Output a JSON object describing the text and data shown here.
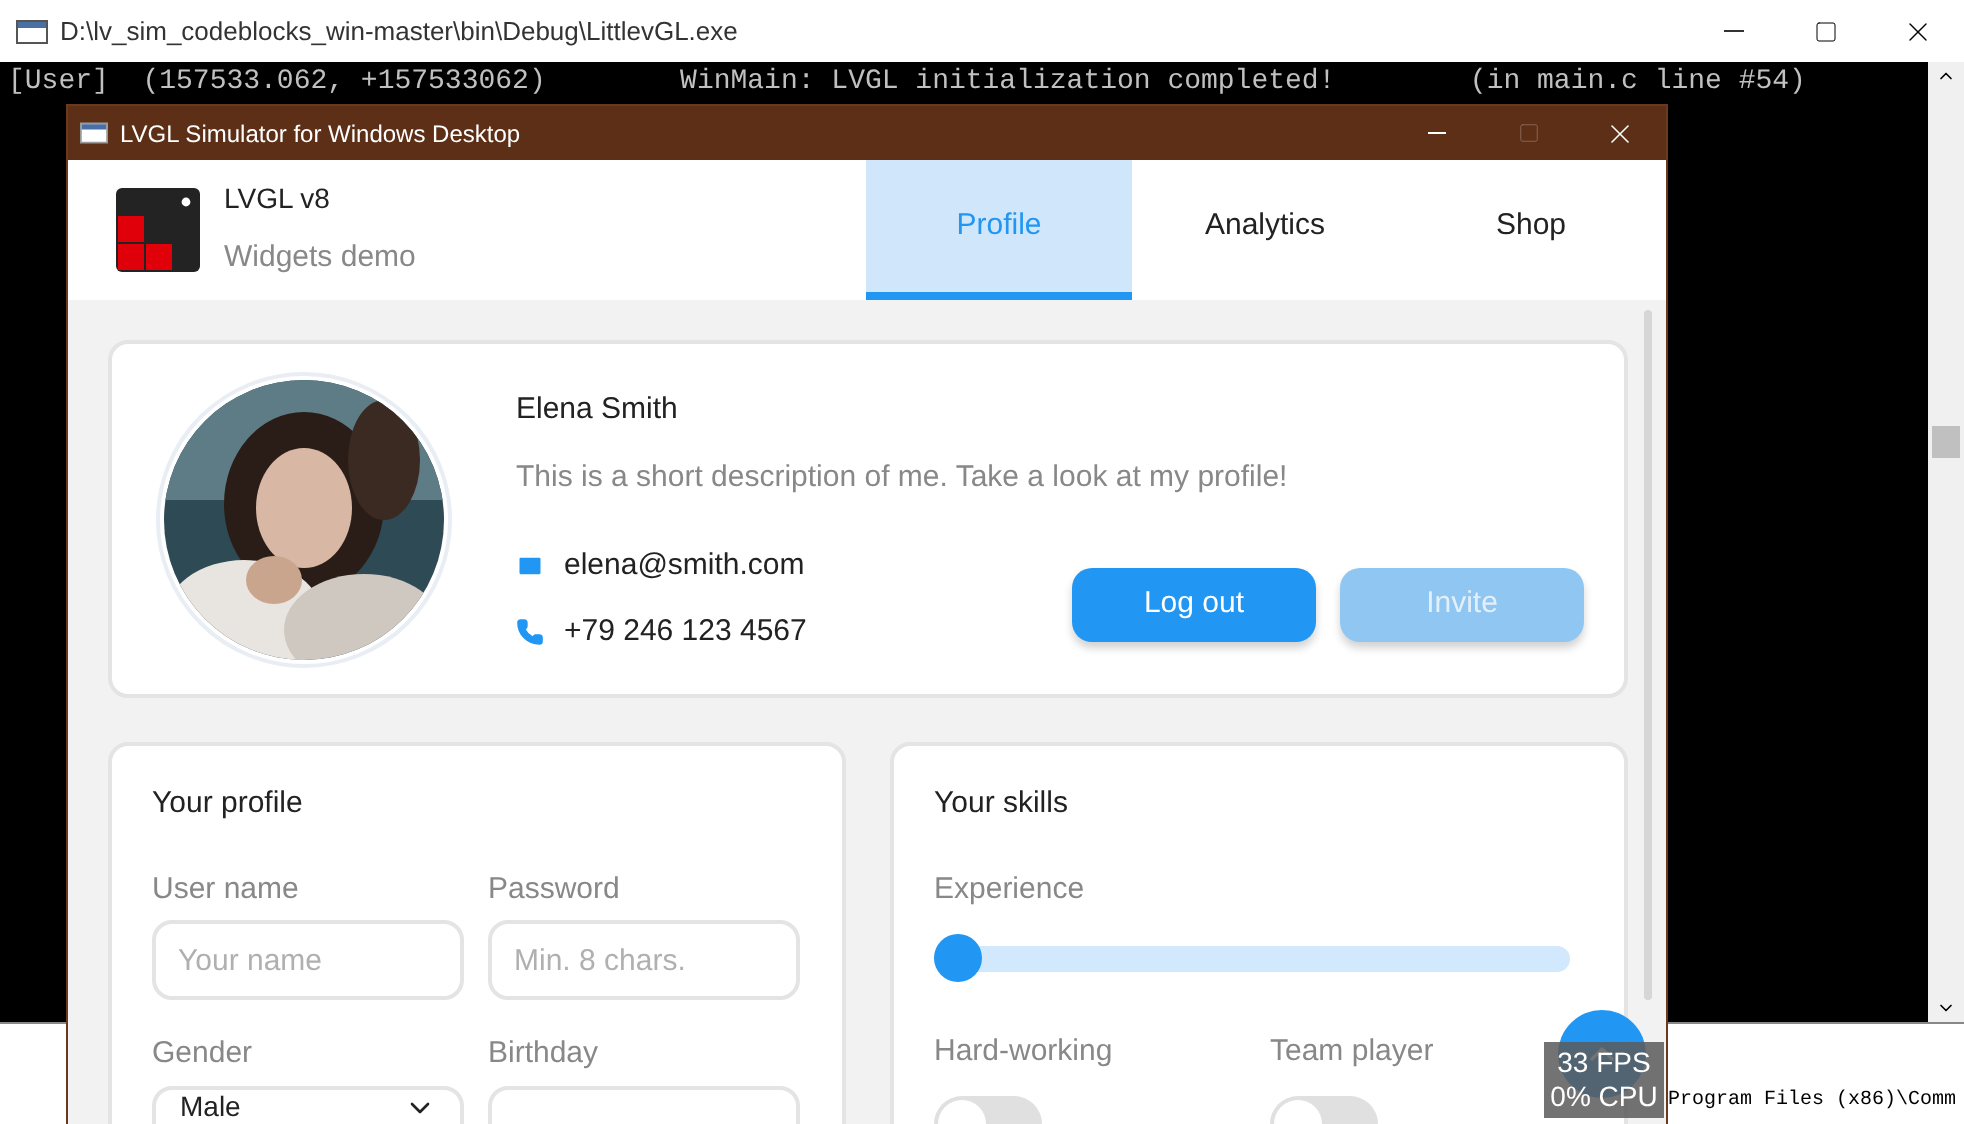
{
  "console": {
    "title": "D:\\lv_sim_codeblocks_win-master\\bin\\Debug\\LittlevGL.exe",
    "lines": [
      "[User]  (157533.062, +157533062)        WinMain: LVGL initialization completed!        (in main.c line #54)"
    ]
  },
  "background_window": {
    "text": "Program Files (x86)\\Comm"
  },
  "simulator": {
    "title": "LVGL Simulator for Windows Desktop",
    "app": {
      "name": "LVGL v8",
      "subtitle": "Widgets demo"
    },
    "tabs": [
      {
        "label": "Profile",
        "selected": true
      },
      {
        "label": "Analytics",
        "selected": false
      },
      {
        "label": "Shop",
        "selected": false
      }
    ],
    "profile": {
      "name": "Elena Smith",
      "description": "This is a short description of me. Take a look at my profile!",
      "email": "elena@smith.com",
      "phone": "+79 246 123 4567",
      "buttons": [
        {
          "label": "Log out",
          "disabled": false
        },
        {
          "label": "Invite",
          "disabled": true
        }
      ]
    },
    "your_profile": {
      "title": "Your profile",
      "fields": [
        {
          "kind": "text",
          "label": "User name",
          "placeholder": "Your name"
        },
        {
          "kind": "text",
          "label": "Password",
          "placeholder": "Min. 8 chars."
        },
        {
          "kind": "dropdown",
          "label": "Gender",
          "value": "Male"
        },
        {
          "kind": "text",
          "label": "Birthday"
        }
      ]
    },
    "your_skills": {
      "title": "Your skills",
      "slider": {
        "label": "Experience",
        "level": 0
      },
      "switches": [
        {
          "label": "Hard-working",
          "on": false
        },
        {
          "label": "Team player",
          "on": false
        }
      ]
    }
  },
  "perf": {
    "fps": "33 FPS",
    "cpu": "0% CPU"
  }
}
